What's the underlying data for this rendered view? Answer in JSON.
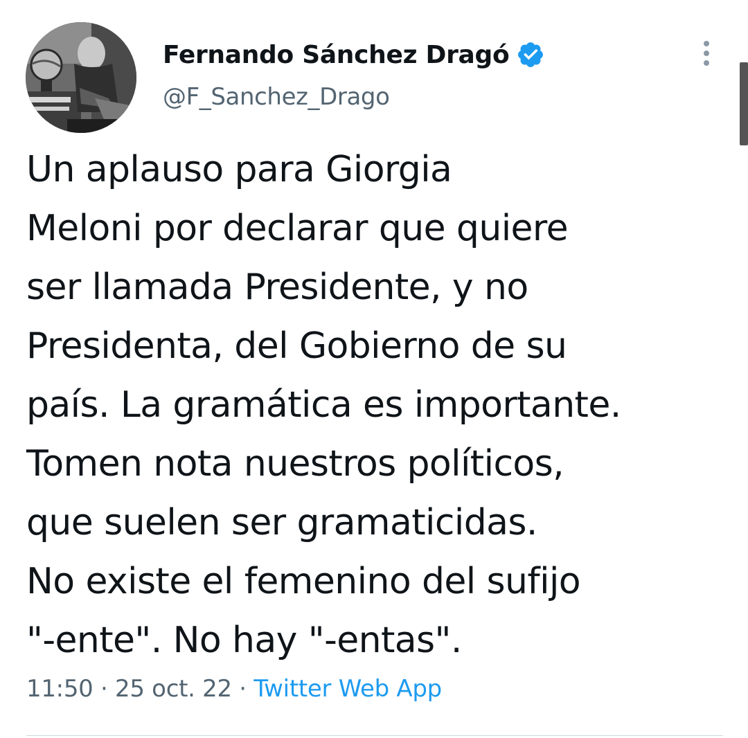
{
  "author": {
    "display_name": "Fernando Sánchez Dragó",
    "handle": "@F_Sanchez_Drago",
    "verified": true,
    "avatar_icon": "profile-photo"
  },
  "tweet": {
    "lines": [
      "Un aplauso para Giorgia",
      "Meloni por declarar que quiere",
      "ser llamada Presidente, y no",
      "Presidenta, del Gobierno de su",
      "país. La gramática es importante.",
      "Tomen nota nuestros políticos,",
      "que suelen ser gramaticidas.",
      "No existe el femenino del sufijo",
      "\"-ente\". No hay \"-entas\"."
    ]
  },
  "meta": {
    "time": "11:50",
    "separator": " · ",
    "date": "25 oct. 22",
    "source": "Twitter Web App"
  },
  "icons": {
    "verified": "verified-badge-icon",
    "more": "more-vertical-icon"
  },
  "colors": {
    "text": "#0f1419",
    "secondary": "#536471",
    "link": "#1d9bf0",
    "verified": "#1d9bf0"
  }
}
